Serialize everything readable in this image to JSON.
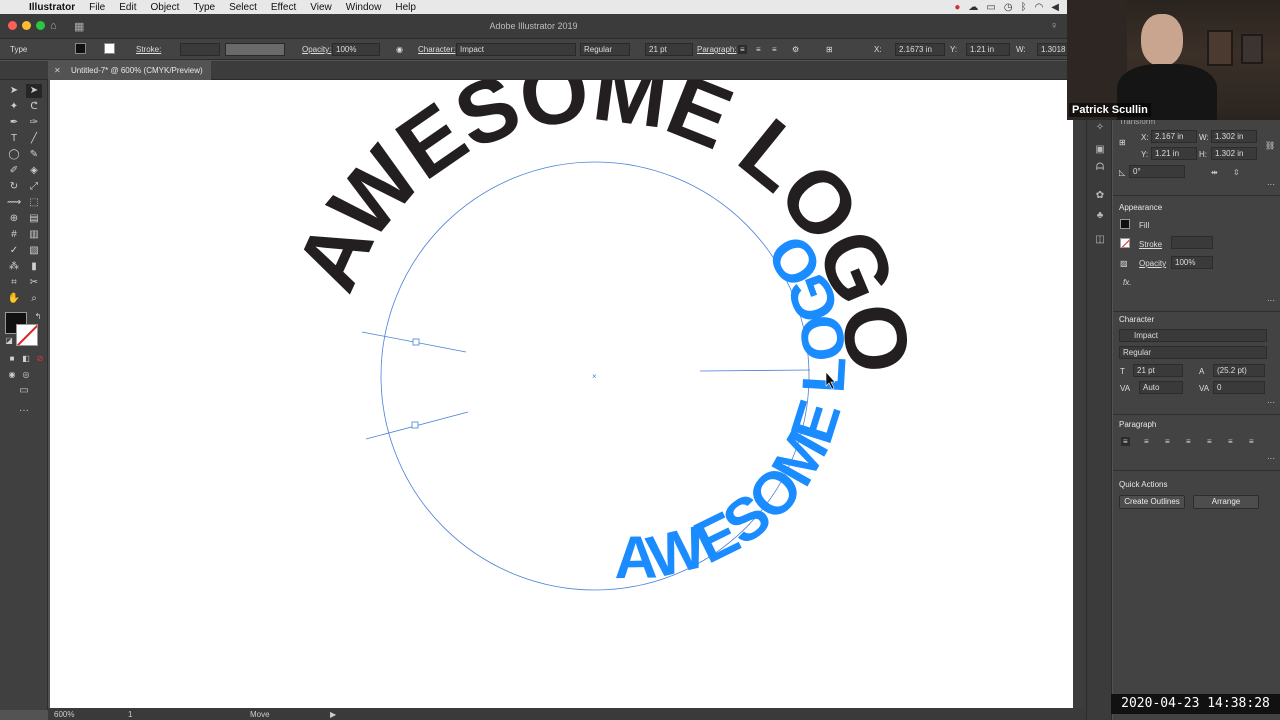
{
  "menubar": {
    "app": "Illustrator",
    "items": [
      "File",
      "Edit",
      "Object",
      "Type",
      "Select",
      "Effect",
      "View",
      "Window",
      "Help"
    ]
  },
  "titlebar": {
    "title": "Adobe Illustrator 2019"
  },
  "control": {
    "tool": "Type",
    "stroke_label": "Stroke:",
    "opacity_label": "Opacity:",
    "opacity_value": "100%",
    "character_label": "Character:",
    "font": "Impact",
    "style": "Regular",
    "size": "21 pt",
    "paragraph_label": "Paragraph:",
    "x_label": "X:",
    "x_value": "2.1673 in",
    "y_label": "Y:",
    "y_value": "1.21 in",
    "w_label": "W:",
    "w_value": "1.3018"
  },
  "doc_tab": {
    "title": "Untitled-7* @ 600% (CMYK/Preview)"
  },
  "artwork": {
    "top_text": "AWESOME LOGO",
    "bottom_text": "AWESOME LOGO",
    "top_color": "#231f20",
    "bottom_color": "#1a8cff",
    "path_color": "#4a7fd8"
  },
  "status": {
    "zoom": "600%",
    "page": "1",
    "tool_hint": "Move"
  },
  "panel": {
    "transform_title": "Transform",
    "x_label": "X:",
    "x": "2.167 in",
    "y_label": "Y:",
    "y": "1.21 in",
    "w_label": "W:",
    "w": "1.302 in",
    "h_label": "H:",
    "h": "1.302 in",
    "angle": "0°",
    "appearance_title": "Appearance",
    "fill_label": "Fill",
    "stroke_label": "Stroke",
    "opacity_label": "Opacity",
    "opacity": "100%",
    "fx": "fx.",
    "character_title": "Character",
    "font": "Impact",
    "style": "Regular",
    "size": "21 pt",
    "leading": "(25.2 pt)",
    "kerning": "Auto",
    "tracking": "0",
    "paragraph_title": "Paragraph",
    "quick_actions_title": "Quick Actions",
    "create_outlines": "Create Outlines",
    "arrange": "Arrange"
  },
  "webcam": {
    "name": "Patrick Scullin"
  },
  "timestamp": "2020-04-23 14:38:28"
}
